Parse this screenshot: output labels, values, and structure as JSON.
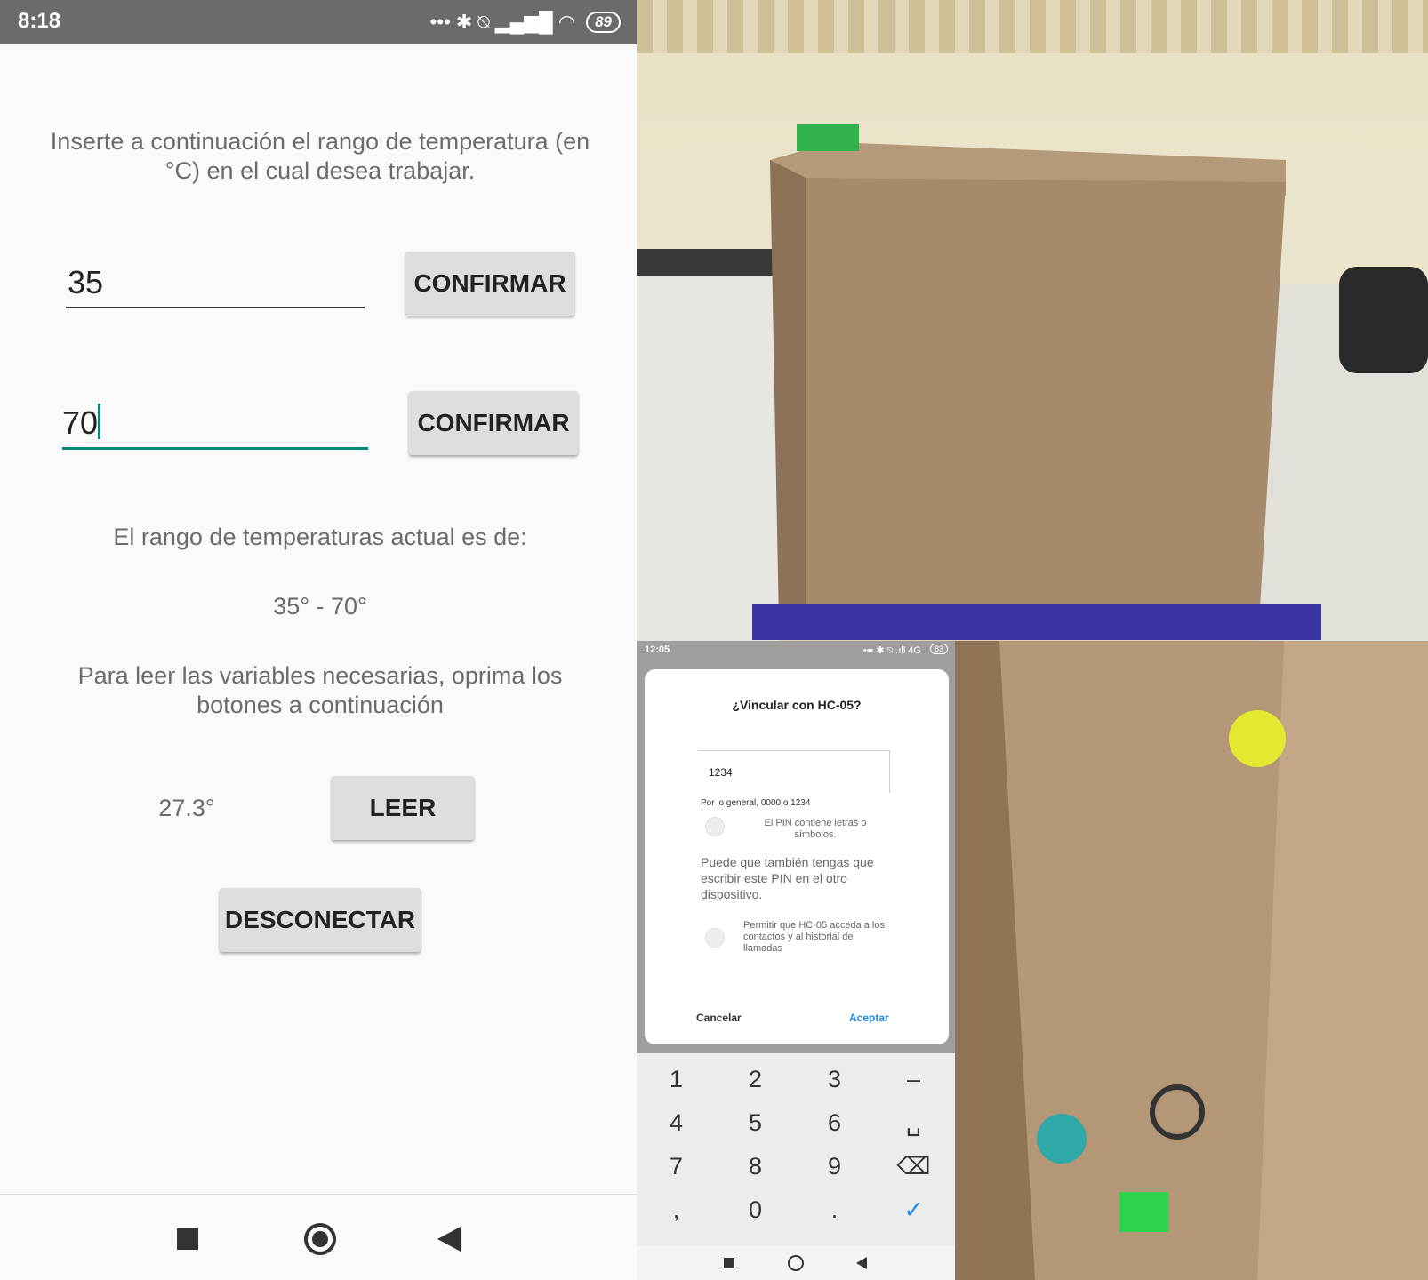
{
  "left_phone": {
    "status_bar": {
      "time": "8:18",
      "icons": "••• ✱ ⍉ ▂▄▆█ ◠",
      "battery": "89"
    },
    "instruction": "Inserte a continuación el rango de temperatura (en °C) en el cual desea trabajar.",
    "min_input": {
      "value": "35"
    },
    "max_input": {
      "value": "70"
    },
    "confirm_label": "CONFIRMAR",
    "current_range_label": "El rango de temperaturas actual es de:",
    "current_range_value": "35° - 70°",
    "read_instruction": "Para leer las variables necesarias, oprima los botones a continuación",
    "temperature_value": "27.3°",
    "read_button": "LEER",
    "disconnect_button": "DESCONECTAR",
    "nav": {
      "recents": "recents-icon",
      "home": "home-icon",
      "back": "back-icon"
    }
  },
  "pair_dialog_phone": {
    "status_bar": {
      "time": "12:05",
      "icons": "••• ✱ ⍉ .ıll 4G",
      "battery": "83"
    },
    "dialog": {
      "title": "¿Vincular con HC-05?",
      "pin_value": "1234",
      "pin_hint": "Por lo general, 0000 o 1234",
      "checkbox_pin_letters": "El PIN contiene letras o símbolos.",
      "info": "Puede que también tengas que escribir este PIN en el otro dispositivo.",
      "checkbox_contacts": "Permitir que HC-05 acceda a los contactos y al historial de llamadas",
      "cancel": "Cancelar",
      "accept": "Aceptar",
      "accent_color": "#1e88e5"
    },
    "keypad": {
      "rows": [
        [
          "1",
          "2",
          "3",
          "–"
        ],
        [
          "4",
          "5",
          "6",
          "␣"
        ],
        [
          "7",
          "8",
          "9",
          "⌫"
        ],
        [
          ",",
          "0",
          ".",
          "✓"
        ]
      ]
    }
  },
  "colors": {
    "accent": "#00897b",
    "status_bar": "#6b6b6b",
    "button": "#dedede"
  }
}
